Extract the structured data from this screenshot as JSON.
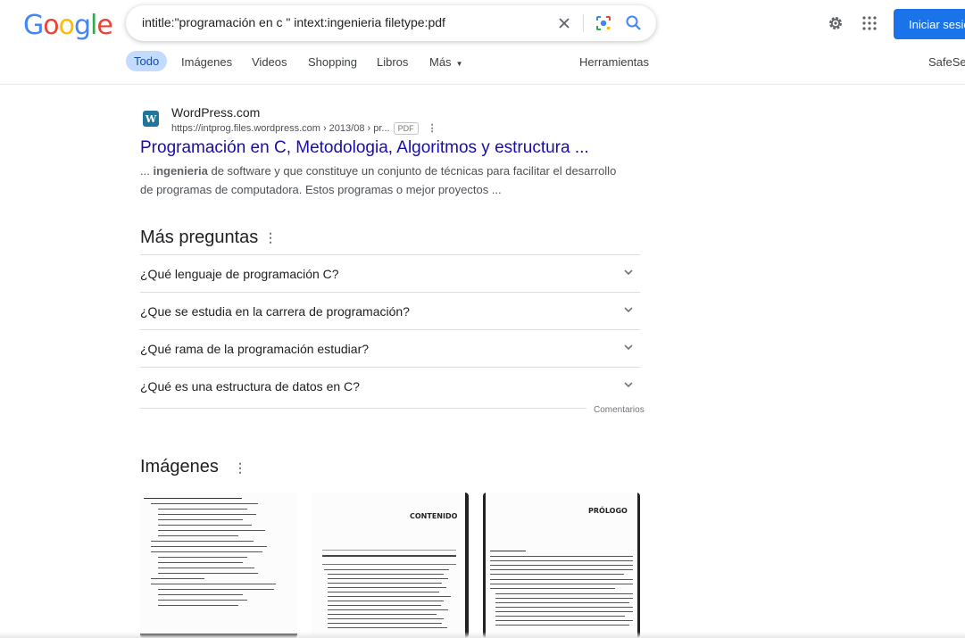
{
  "header": {
    "logo_letters": [
      "G",
      "o",
      "o",
      "g",
      "l",
      "e"
    ],
    "search_query": "intitle:\"programación en c \" intext:ingenieria filetype:pdf",
    "signin_label": "Iniciar sesión"
  },
  "tabs": {
    "items": [
      "Todo",
      "Imágenes",
      "Videos",
      "Shopping",
      "Libros",
      "Más"
    ],
    "tools": "Herramientas",
    "safesearch": "SafeSearch"
  },
  "result": {
    "site_name": "WordPress.com",
    "url": "https://intprog.files.wordpress.com › 2013/08 › pr...",
    "badge": "PDF",
    "title": "Programación en C, Metodologia, Algoritmos y estructura ...",
    "snippet_prefix": "... ",
    "snippet_bold": "ingenieria",
    "snippet_rest": " de software y que constituye un conjunto de técnicas para facilitar el desarrollo de programas de computadora. Estos programas o mejor proyectos ..."
  },
  "paa": {
    "heading": "Más preguntas",
    "questions": [
      "¿Qué lenguaje de programación C?",
      "¿Que se estudia en la carrera de programación?",
      "¿Qué rama de la programación estudiar?",
      "¿Qué es una estructura de datos en C?"
    ],
    "feedback": "Comentarios"
  },
  "images": {
    "heading": "Imágenes",
    "thumb_titles": [
      "",
      "CONTENIDO",
      "PRÓLOGO"
    ]
  },
  "colors": {
    "accent": "#1a73e8",
    "link": "#1a0dab",
    "active_tab_bg": "#c2dbff"
  },
  "icons": [
    "clear-icon",
    "lens-icon",
    "search-icon",
    "gear-icon",
    "apps-grid-icon",
    "chevron-down-icon",
    "more-vert-icon"
  ]
}
